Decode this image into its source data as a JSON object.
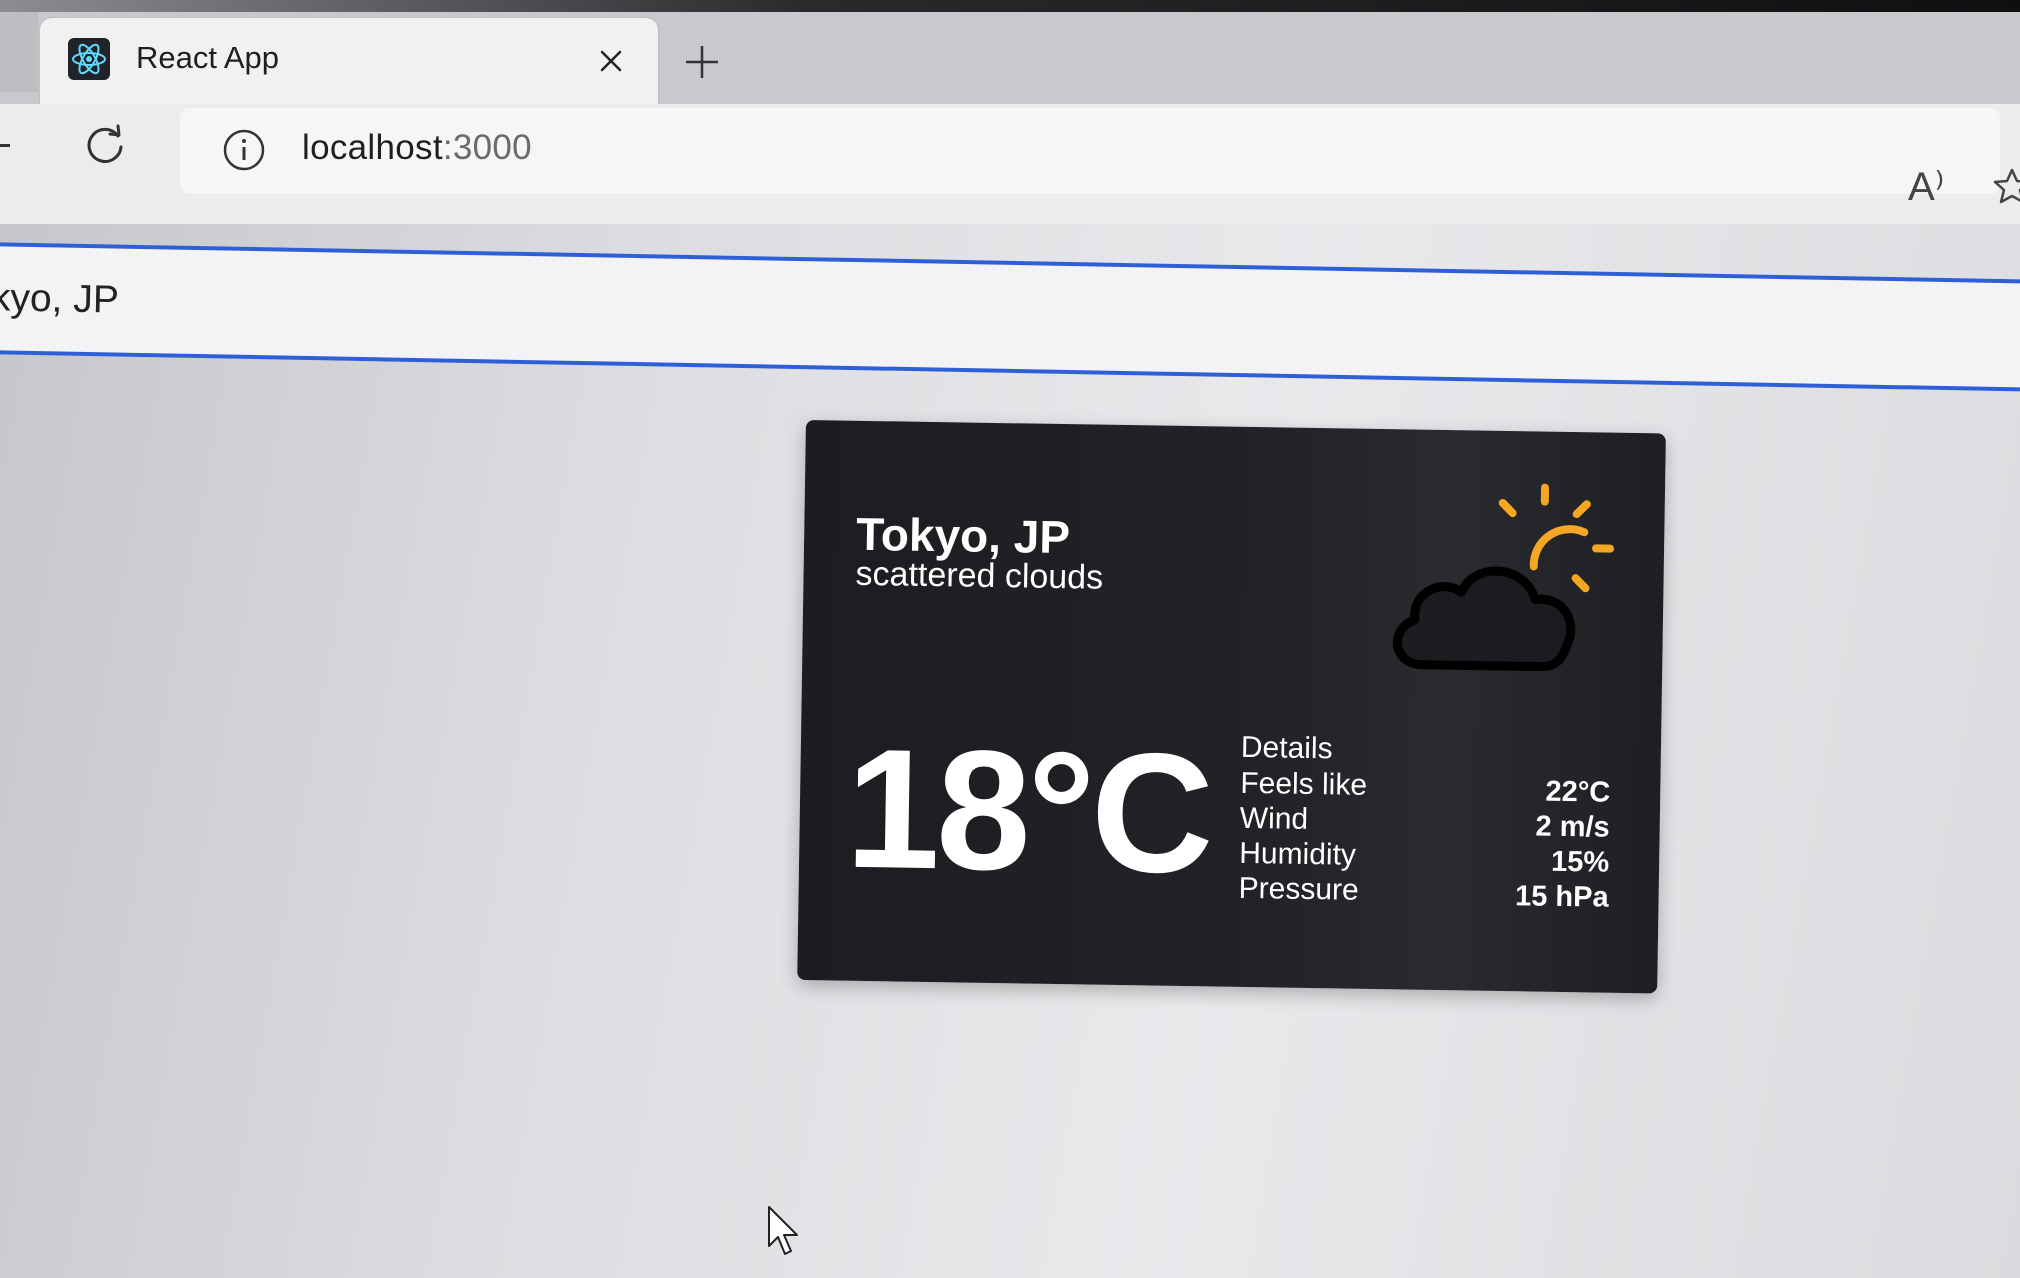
{
  "browser": {
    "tab": {
      "title": "React App",
      "favicon": "react-logo-icon",
      "close_icon": "close-icon"
    },
    "new_tab_icon": "plus-icon",
    "reload_icon": "reload-icon",
    "site_info_icon": "info-icon",
    "url": {
      "host": "localhost",
      "port": ":3000"
    },
    "read_aloud_label": "A⁾",
    "favorite_icon": "star-icon"
  },
  "search": {
    "value": "kyo, JP"
  },
  "weather": {
    "city": "Tokyo, JP",
    "description": "scattered clouds",
    "icon": "partly-cloudy-icon",
    "temperature": "18°C",
    "details_heading": "Details",
    "details": [
      {
        "label": "Feels like",
        "value": "22°C"
      },
      {
        "label": "Wind",
        "value": "2 m/s"
      },
      {
        "label": "Humidity",
        "value": "15%"
      },
      {
        "label": "Pressure",
        "value": "15 hPa"
      }
    ],
    "colors": {
      "card_bg": "#222327",
      "sun": "#f5a623",
      "text": "#ffffff"
    }
  }
}
